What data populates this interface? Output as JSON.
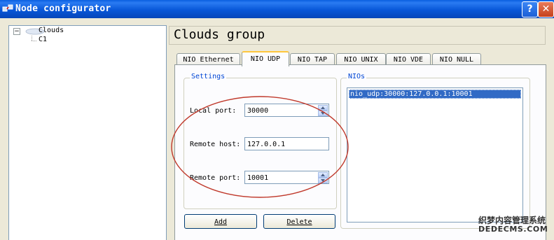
{
  "window": {
    "title": "Node configurator",
    "help_glyph": "?",
    "close_glyph": "✕"
  },
  "tree": {
    "expander_glyph": "−",
    "root_label": "Clouds",
    "child_label": "C1"
  },
  "group": {
    "title": "Clouds group"
  },
  "tabs": [
    {
      "label": "NIO Ethernet",
      "active": false
    },
    {
      "label": "NIO UDP",
      "active": true
    },
    {
      "label": "NIO TAP",
      "active": false
    },
    {
      "label": "NIO UNIX",
      "active": false
    },
    {
      "label": "NIO VDE",
      "active": false
    },
    {
      "label": "NIO NULL",
      "active": false
    }
  ],
  "settings": {
    "legend": "Settings",
    "local_port_label": "Local port:",
    "local_port_value": "30000",
    "remote_host_label": "Remote host:",
    "remote_host_value": "127.0.0.1",
    "remote_port_label": "Remote port:",
    "remote_port_value": "10001"
  },
  "nios": {
    "legend": "NIOs",
    "items": [
      "nio_udp:30000:127.0.0.1:10001"
    ]
  },
  "buttons": {
    "add_label": "Add",
    "delete_label": "Delete"
  },
  "watermark": {
    "line1": "织梦内容管理系统",
    "line2": "DEDECMS.COM"
  },
  "colors": {
    "titlebar": "#0a5fe0",
    "selection": "#316ac5",
    "annotation_circle": "#c0392b",
    "legend_text": "#0046d5"
  }
}
